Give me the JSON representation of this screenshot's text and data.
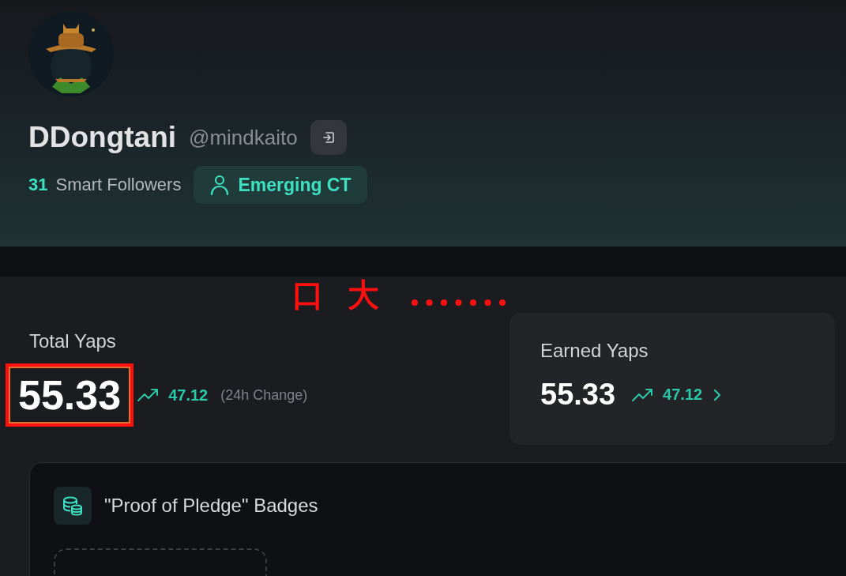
{
  "profile": {
    "name": "DDongtani",
    "handle": "@mindkaito",
    "smart_followers_count": "31",
    "smart_followers_label": "Smart Followers",
    "tag": "Emerging CT"
  },
  "annotation": {
    "marks": [
      "口",
      "大"
    ]
  },
  "total_yaps": {
    "label": "Total Yaps",
    "value": "55.33",
    "highlighted": true,
    "change": "47.12",
    "change_label": "(24h Change)"
  },
  "earned_yaps": {
    "label": "Earned Yaps",
    "value": "55.33",
    "change": "47.12"
  },
  "badges": {
    "title": "\"Proof of Pledge\" Badges"
  }
}
